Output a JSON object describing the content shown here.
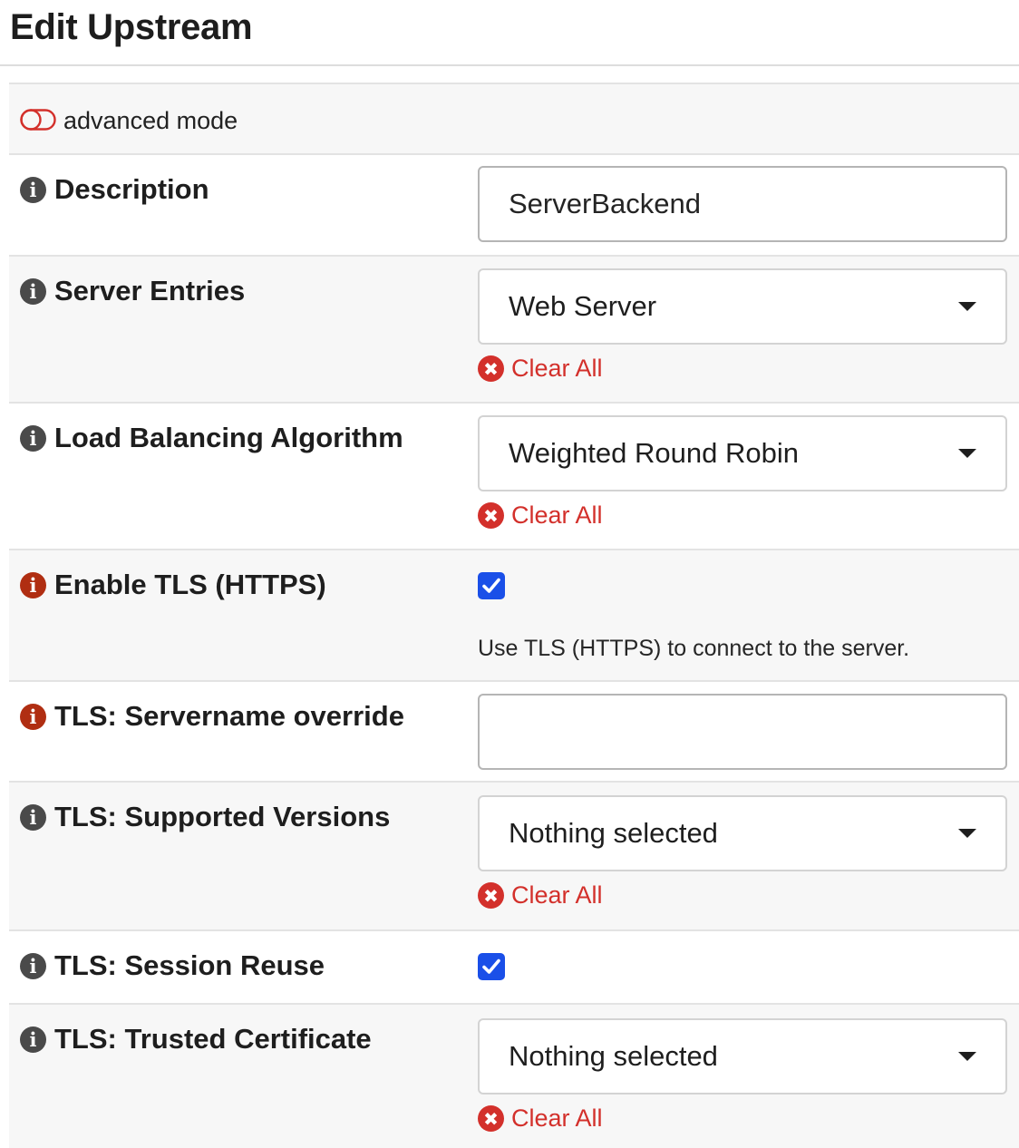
{
  "page": {
    "title": "Edit Upstream"
  },
  "advanced_mode": {
    "label": "advanced mode",
    "enabled": false,
    "icon": "toggle-off-icon",
    "color": "#d3302b"
  },
  "colors": {
    "accent_checkbox": "#1a4fe8",
    "danger": "#d3302b",
    "info_icon_default": "#4a4a4a",
    "info_icon_highlight": "#b02e12"
  },
  "fields": [
    {
      "id": "description",
      "label": "Description",
      "type": "text",
      "value": "ServerBackend",
      "info_icon": "info-icon",
      "info_highlight": false
    },
    {
      "id": "server_entries",
      "label": "Server Entries",
      "type": "select",
      "value": "Web Server",
      "clear_label": "Clear All",
      "info_icon": "info-icon",
      "info_highlight": false
    },
    {
      "id": "load_balancing",
      "label": "Load Balancing Algorithm",
      "type": "select",
      "value": "Weighted Round Robin",
      "clear_label": "Clear All",
      "info_icon": "info-icon",
      "info_highlight": false
    },
    {
      "id": "enable_tls",
      "label": "Enable TLS (HTTPS)",
      "type": "checkbox",
      "checked": true,
      "help_text": "Use TLS (HTTPS) to connect to the server.",
      "info_icon": "info-icon",
      "info_highlight": true
    },
    {
      "id": "tls_servername",
      "label": "TLS: Servername override",
      "type": "text",
      "value": "",
      "info_icon": "info-icon",
      "info_highlight": true
    },
    {
      "id": "tls_versions",
      "label": "TLS: Supported Versions",
      "type": "select",
      "value": "Nothing selected",
      "clear_label": "Clear All",
      "info_icon": "info-icon",
      "info_highlight": false
    },
    {
      "id": "tls_session_reuse",
      "label": "TLS: Session Reuse",
      "type": "checkbox",
      "checked": true,
      "info_icon": "info-icon",
      "info_highlight": false
    },
    {
      "id": "tls_trusted_cert",
      "label": "TLS: Trusted Certificate",
      "type": "select",
      "value": "Nothing selected",
      "clear_label": "Clear All",
      "info_icon": "info-icon",
      "info_highlight": false
    }
  ]
}
